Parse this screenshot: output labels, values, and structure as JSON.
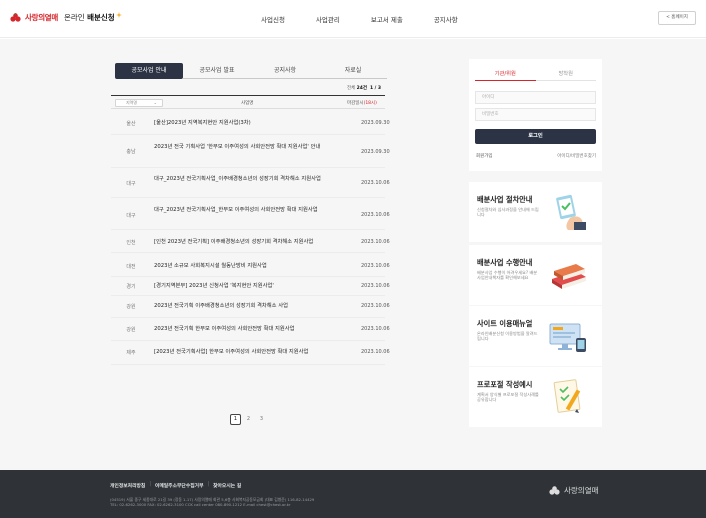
{
  "header": {
    "logo_text": "사랑의열매",
    "service_prefix": "온라인 ",
    "service_bold": "배분신청",
    "nav": [
      "사업신청",
      "사업관리",
      "보고서 제출",
      "공지사항"
    ],
    "home_button": "< 홈페이지"
  },
  "board": {
    "tabs": [
      {
        "label": "공모사업 안내",
        "active": true
      },
      {
        "label": "공모사업 발표",
        "active": false
      },
      {
        "label": "공지사항",
        "active": false
      },
      {
        "label": "자료실",
        "active": false
      }
    ],
    "total_label": "전체",
    "total_count": "24건",
    "page_indicator": "1 / 3",
    "filter_placeholder": "지역명",
    "col_title": "사업명",
    "col_date": "마감일시",
    "col_date_highlight": "(18시)",
    "rows": [
      {
        "region": "울산",
        "title": "[울산]2023년 지역복지현안 지원사업(3차)",
        "date": "2023.09.30"
      },
      {
        "region": "충남",
        "title": "2023년 전국 기획사업 '한부모 이주여성의 사회안전망 확대 지원사업' 안내",
        "date": "2023.09.30"
      },
      {
        "region": "대구",
        "title": "대구_2023년 전국기획사업_이주배경청소년의 성장기회 격차해소 지원사업",
        "date": "2023.10.06"
      },
      {
        "region": "대구",
        "title": "대구_2023년 전국기획사업_한부모 이주여성의 사회안전망 확대 지원사업",
        "date": "2023.10.06"
      },
      {
        "region": "인천",
        "title": "[인천 2023년 전국기획] 이주배경청소년의 성장기회 격차해소 지원사업",
        "date": "2023.10.06"
      },
      {
        "region": "대전",
        "title": "2023년 소규모 사회복지시설 월동난방비 지원사업",
        "date": "2023.10.06"
      },
      {
        "region": "경기",
        "title": "[경기지역본부] 2023년 신청사업 '복지현안 지원사업'",
        "date": "2023.10.06"
      },
      {
        "region": "강원",
        "title": "2023년 전국기획 이주배경청소년의 성장기회 격차해소 사업",
        "date": "2023.10.06"
      },
      {
        "region": "강원",
        "title": "2023년 전국기획 한부모 이주여성의 사회안전망 확대 지원사업",
        "date": "2023.10.06"
      },
      {
        "region": "제주",
        "title": "[2023년 전국기획사업] 한부모 이주여성의 사회안전망 확대 지원사업",
        "date": "2023.10.06"
      }
    ],
    "pages": [
      "1",
      "2",
      "3"
    ]
  },
  "login": {
    "tabs": [
      {
        "label": "기관/위원",
        "active": true
      },
      {
        "label": "방착원",
        "active": false
      }
    ],
    "id_placeholder": "아이디",
    "pw_placeholder": "비밀번호",
    "login_button": "로그인",
    "join_link": "회원가입",
    "find_link": "아이디/비밀번호찾기"
  },
  "cards": [
    {
      "title": "배분사업 절차안내",
      "desc": "신청절차와 심사과정을 안내해 드립니다",
      "icon": "clipboard-hand-icon"
    },
    {
      "title": "배분사업 수행안내",
      "desc": "배분사업 수행이 어려우세요? 배분사업안내책자를 확인해보세요",
      "icon": "books-icon"
    },
    {
      "title": "사이트 이용매뉴얼",
      "desc": "온라인배분신청 이용방법을 알려드립니다",
      "icon": "monitor-icon"
    },
    {
      "title": "프로포절 작성예시",
      "desc": "계획서 양식별 프로포절 작성사례를 공유합니다",
      "icon": "document-pencil-icon"
    }
  ],
  "footer": {
    "links": [
      "개인정보처리방침",
      "이메일주소무단수집거부",
      "찾아오시는 길"
    ],
    "address_line1": "(04519) 서울 중구 세종대로 21길 39 (정동 1-17) 사랑의열매 회관 5,6층 사회복지공동모금회 (대표 김병준) 116-82-14429",
    "address_line2": "TEL: 02-6262-3000 FAX: 02-6262-3100 CCK call center 080-890-1212 E-mail chest@chest.or.kr",
    "logo_text": "사랑의열매"
  }
}
